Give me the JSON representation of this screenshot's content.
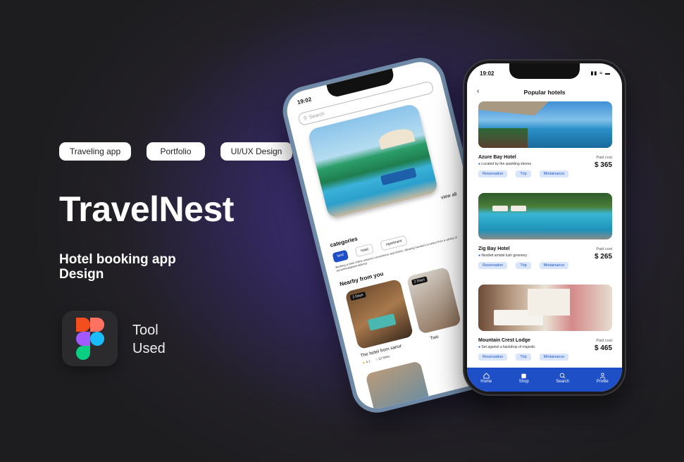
{
  "tags": [
    "Traveling app",
    "Portfolio",
    "UI/UX Design"
  ],
  "title": "TravelNest",
  "subtitle": "Hotel booking app Design",
  "tool": {
    "label_1": "Tool",
    "label_2": "Used",
    "icon": "figma-logo-icon"
  },
  "back_phone": {
    "time": "19:02",
    "search_placeholder": "Search",
    "view_all": "view all",
    "categories_title": "categories",
    "categories": [
      "land",
      "hotel",
      "Apartment"
    ],
    "description": "Booking a hotel online ensures convenience and choice, allowing travelers to select from a variety of accommodations tailored",
    "view": "Vi",
    "nearby_title": "Nearby from you",
    "nearby": [
      {
        "badge": "2 Days",
        "name": "The hotel from sanur",
        "rating": "4.1",
        "distance": "22 Miles"
      },
      {
        "badge": "2 Days",
        "name": "Two"
      }
    ]
  },
  "front_phone": {
    "time": "19:02",
    "header_title": "Popular hotels",
    "hotels": [
      {
        "name": "Azure Bay Hotel",
        "location": "Located by the sparkling shores",
        "paid_label": "Paid cost",
        "price": "$ 365",
        "tags": [
          "Reservation",
          "Trip",
          "Mintainance"
        ]
      },
      {
        "name": "Zig Bay Hotel",
        "location": "Nestled amidst lush greenery",
        "paid_label": "Paid cost",
        "price": "$ 265",
        "tags": [
          "Reservation",
          "Trip",
          "Mintainance"
        ]
      },
      {
        "name": "Mountain Crest Lodge",
        "location": "Set against a backdrop of majestic",
        "paid_label": "Paid cost",
        "price": "$ 465",
        "tags": [
          "Reservation",
          "Trip",
          "Mintainance"
        ]
      }
    ],
    "tabs": [
      {
        "label": "Home",
        "icon": "home-icon"
      },
      {
        "label": "Shop",
        "icon": "shop-icon"
      },
      {
        "label": "Search",
        "icon": "search-icon"
      },
      {
        "label": "Profile",
        "icon": "profile-icon"
      }
    ]
  },
  "colors": {
    "accent": "#1e4fc7",
    "chip_bg": "#d9e5fb"
  }
}
